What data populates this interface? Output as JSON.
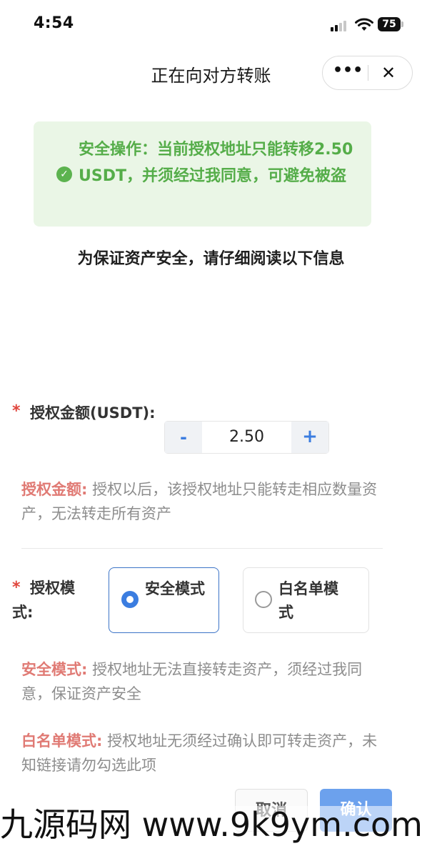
{
  "status_bar": {
    "time": "4:54",
    "battery": "75"
  },
  "nav": {
    "title": "正在向对方转账",
    "more": "•••",
    "close": "✕"
  },
  "notice": {
    "text": "安全操作：当前授权地址只能转移2.50 USDT，并须经过我同意，可避免被盗",
    "icon": "check-circle-icon"
  },
  "intro": "为保证资产安全，请仔细阅读以下信息",
  "amount": {
    "required_mark": "*",
    "label": "授权金额(USDT):",
    "minus": "-",
    "plus": "+",
    "value": "2.50",
    "desc_title": "授权金额:",
    "desc_text": " 授权以后，该授权地址只能转走相应数量资产，无法转走所有资产"
  },
  "mode": {
    "required_mark": "*",
    "label_line1": "授权模",
    "label_line2": "式:",
    "options": [
      {
        "label": "安全模式",
        "selected": true
      },
      {
        "label": "白名单模式",
        "selected": false
      }
    ],
    "safe_desc_title": "安全模式:",
    "safe_desc_text": " 授权地址无法直接转走资产，须经过我同意，保证资产安全",
    "white_desc_title": "白名单模式:",
    "white_desc_text": " 授权地址无须经过确认即可转走资产，未知链接请勿勾选此项"
  },
  "actions": {
    "cancel": "取消",
    "confirm": "确认"
  },
  "watermark": "九源码网 www.9k9ym.com",
  "colors": {
    "accent": "#3b7de0",
    "success": "#5cb34f",
    "notice_bg": "#eaf6e6",
    "warning_text": "#e07a74",
    "required": "#e0463d"
  }
}
